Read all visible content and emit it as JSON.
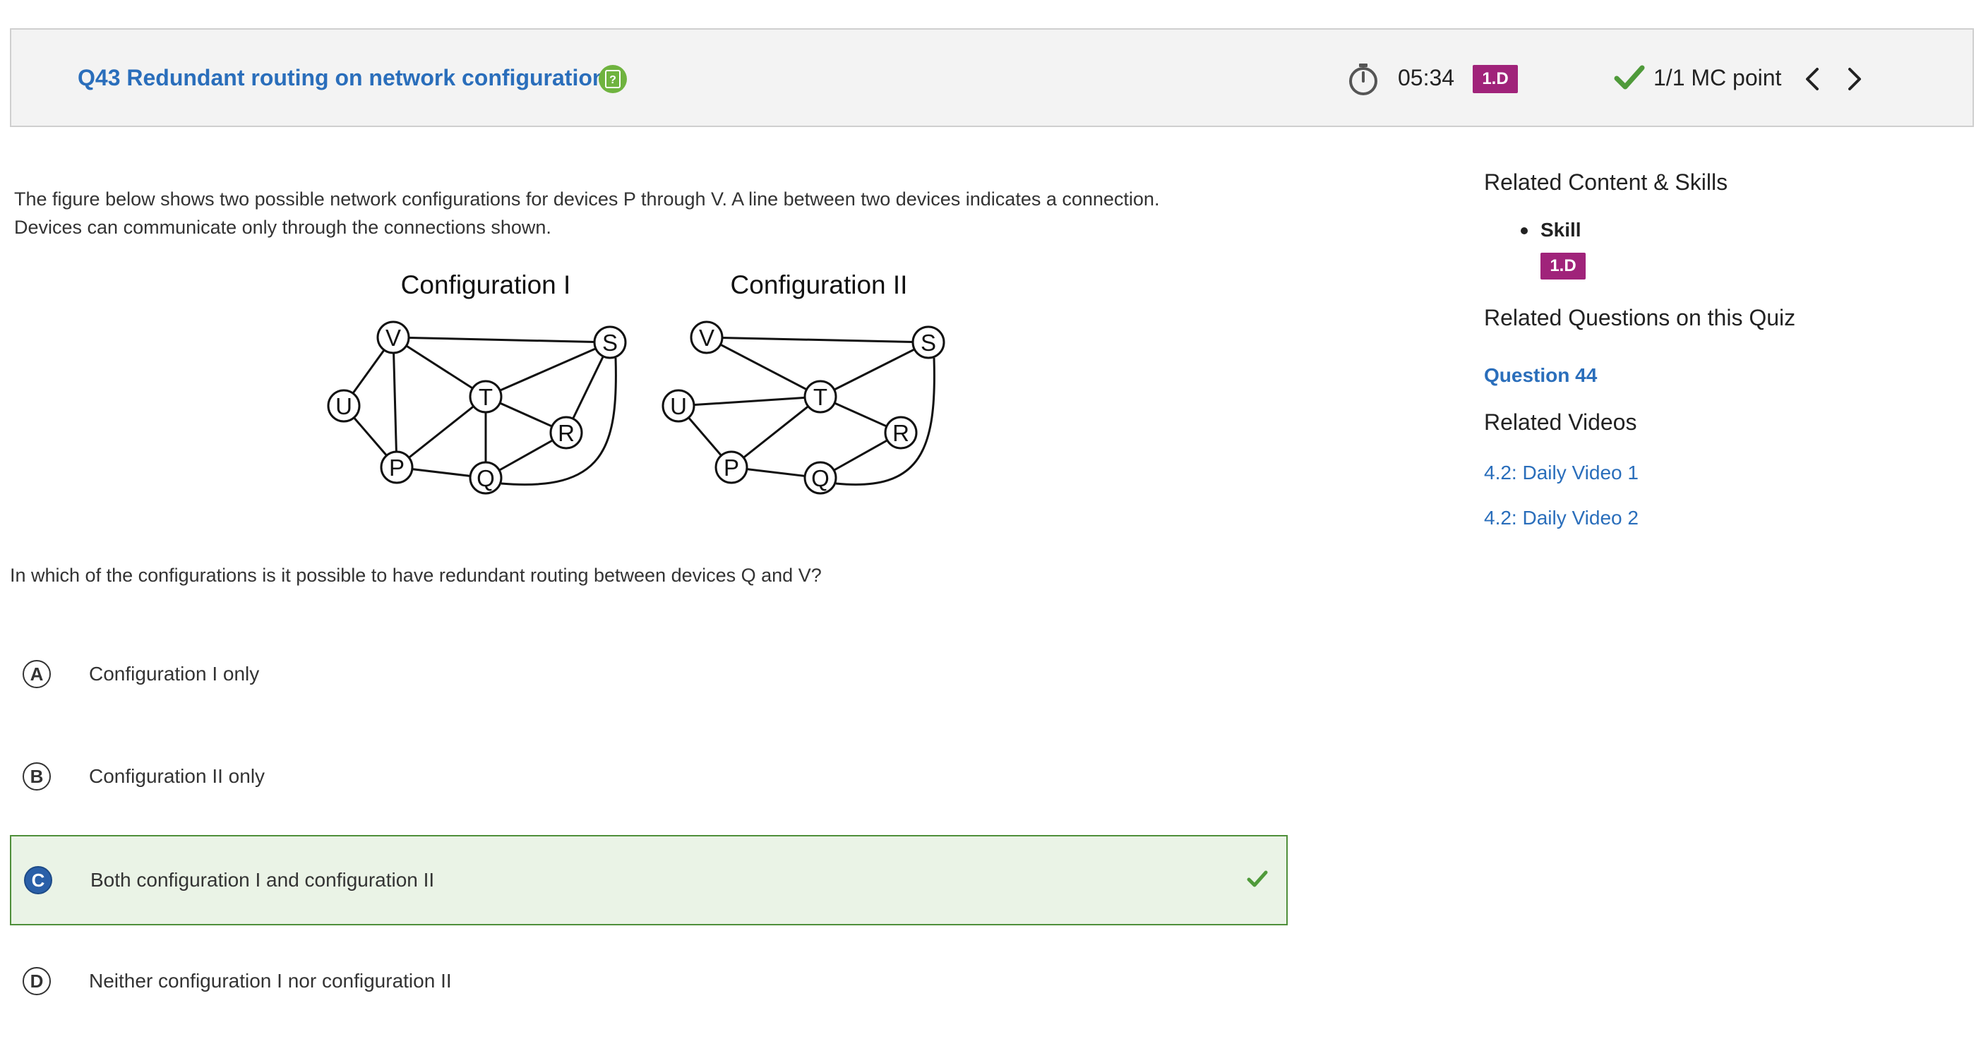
{
  "header": {
    "question_title": "Q43 Redundant routing on network configuration",
    "help_icon": "question-mark-icon",
    "timer": "05:34",
    "skill_badge": "1.D",
    "score": "1/1 MC point"
  },
  "prompt": {
    "intro_line1": "The figure below shows two possible network configurations for devices P through V. A line between two devices indicates a connection.",
    "intro_line2": "Devices can communicate only through the connections shown.",
    "question": "In which of the configurations is it possible to have redundant routing between devices Q and V?"
  },
  "figure": {
    "config1_title": "Configuration I",
    "config2_title": "Configuration II",
    "node_labels": {
      "V": "V",
      "S": "S",
      "U": "U",
      "T": "T",
      "R": "R",
      "P": "P",
      "Q": "Q"
    },
    "config1_edges": [
      [
        "V",
        "S"
      ],
      [
        "V",
        "U"
      ],
      [
        "V",
        "P"
      ],
      [
        "V",
        "T"
      ],
      [
        "U",
        "P"
      ],
      [
        "P",
        "T"
      ],
      [
        "P",
        "Q"
      ],
      [
        "T",
        "S"
      ],
      [
        "T",
        "Q"
      ],
      [
        "T",
        "R"
      ],
      [
        "R",
        "S"
      ],
      [
        "R",
        "Q"
      ],
      [
        "Q",
        "S"
      ]
    ],
    "config2_edges": [
      [
        "V",
        "S"
      ],
      [
        "V",
        "T"
      ],
      [
        "U",
        "T"
      ],
      [
        "U",
        "P"
      ],
      [
        "P",
        "T"
      ],
      [
        "P",
        "Q"
      ],
      [
        "T",
        "S"
      ],
      [
        "T",
        "R"
      ],
      [
        "R",
        "Q"
      ],
      [
        "Q",
        "S"
      ]
    ]
  },
  "choices": [
    {
      "letter": "A",
      "text": "Configuration I only",
      "correct": false
    },
    {
      "letter": "B",
      "text": "Configuration II only",
      "correct": false
    },
    {
      "letter": "C",
      "text": "Both configuration I and configuration II",
      "correct": true
    },
    {
      "letter": "D",
      "text": "Neither configuration I nor configuration II",
      "correct": false
    }
  ],
  "sidebar": {
    "related_content_heading": "Related Content & Skills",
    "skill_label": "Skill",
    "skill_badge": "1.D",
    "related_questions_heading": "Related Questions on this Quiz",
    "related_question_link": "Question 44",
    "related_videos_heading": "Related Videos",
    "videos": [
      "4.2: Daily Video 1",
      "4.2: Daily Video 2"
    ]
  },
  "colors": {
    "title_blue": "#2a6ebb",
    "badge_purple": "#a0237a",
    "correct_green": "#4f8f3a",
    "correct_bg": "#eaf3e6",
    "selected_circle": "#2a5fa8"
  }
}
